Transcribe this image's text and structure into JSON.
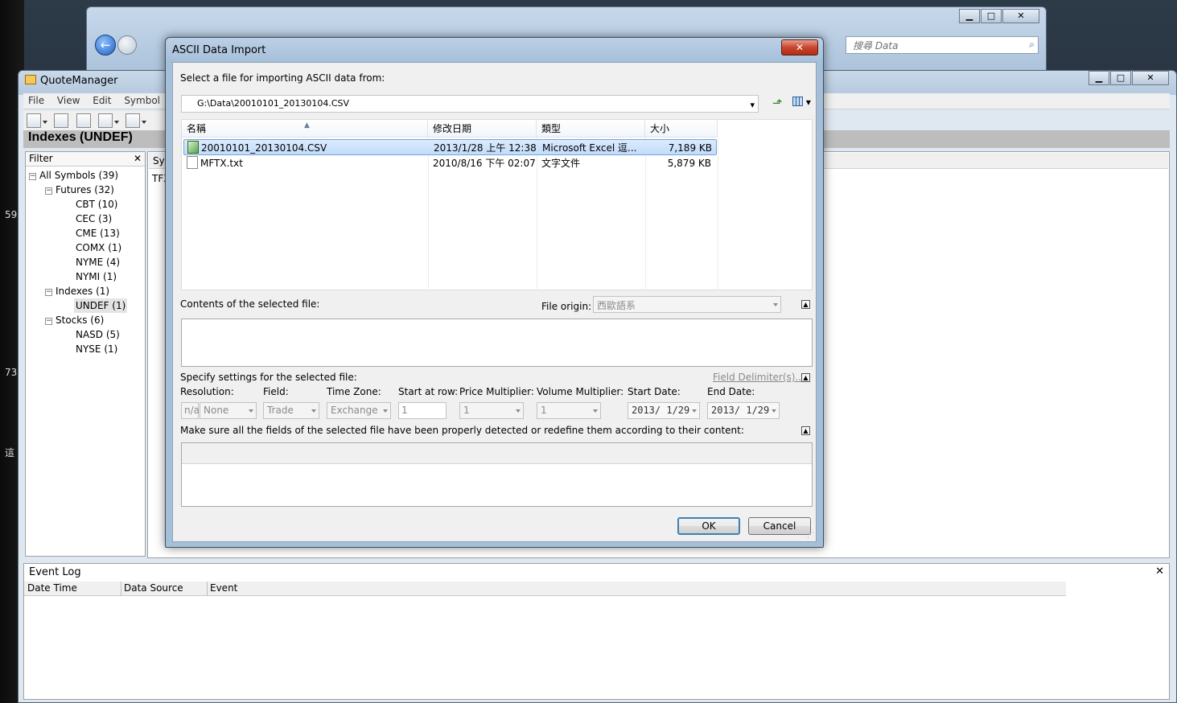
{
  "desktop": {
    "numbers": [
      "59",
      "73",
      "這"
    ]
  },
  "explorer": {
    "search_placeholder": "搜尋 Data",
    "controls": {
      "minimize": "▁",
      "maximize": "□",
      "close": "✕"
    }
  },
  "quote_manager": {
    "title": "QuoteManager",
    "menu": [
      "File",
      "View",
      "Edit",
      "Symbol"
    ],
    "heading": "Indexes (UNDEF)",
    "filter_label": "Filter",
    "filter_close": "✕",
    "mid_header_partial": "Syr",
    "mid_row_partial": "TFX",
    "controls": {
      "minimize": "▁",
      "maximize": "□",
      "close": "✕"
    },
    "tree": [
      {
        "label": "All Symbols (39)",
        "level": 0,
        "expander": "−"
      },
      {
        "label": "Futures (32)",
        "level": 1,
        "expander": "−"
      },
      {
        "label": "CBT (10)",
        "level": 2
      },
      {
        "label": "CEC (3)",
        "level": 2
      },
      {
        "label": "CME (13)",
        "level": 2
      },
      {
        "label": "COMX (1)",
        "level": 2
      },
      {
        "label": "NYME (4)",
        "level": 2
      },
      {
        "label": "NYMI (1)",
        "level": 2
      },
      {
        "label": "Indexes (1)",
        "level": 1,
        "expander": "−"
      },
      {
        "label": "UNDEF (1)",
        "level": 2,
        "selected": true
      },
      {
        "label": "Stocks (6)",
        "level": 1,
        "expander": "−"
      },
      {
        "label": "NASD (5)",
        "level": 2
      },
      {
        "label": "NYSE (1)",
        "level": 2
      }
    ],
    "event_log": {
      "title": "Event Log",
      "close": "✕",
      "columns": [
        "Date Time",
        "Data Source",
        "Event"
      ]
    }
  },
  "dialog": {
    "title": "ASCII Data Import",
    "close": "✕",
    "select_prompt": "Select a file for importing ASCII data from:",
    "path": "G:\\Data\\20010101_20130104.CSV",
    "file_columns": [
      "名稱",
      "修改日期",
      "類型",
      "大小"
    ],
    "files": [
      {
        "name": "20010101_20130104.CSV",
        "modified": "2013/1/28 上午 12:38",
        "type": "Microsoft Excel 逗...",
        "size": "7,189 KB",
        "icon": "excel-csv-icon",
        "selected": true
      },
      {
        "name": "MFTX.txt",
        "modified": "2010/8/16 下午 02:07",
        "type": "文字文件",
        "size": "5,879 KB",
        "icon": "text-file-icon",
        "selected": false
      }
    ],
    "contents_label": "Contents of the selected file:",
    "file_origin_label": "File origin:",
    "file_origin_value": "西歐語系",
    "settings_label": "Specify settings for the selected file:",
    "field_delimiters_link": "Field Delimiter(s)...",
    "resolution_label": "Resolution:",
    "resolution_na": "n/a",
    "resolution_value": "None",
    "field_label": "Field:",
    "field_value": "Trade",
    "timezone_label": "Time Zone:",
    "timezone_value": "Exchange",
    "start_row_label": "Start at row:",
    "start_row_value": "1",
    "price_mult_label": "Price Multiplier:",
    "price_mult_value": "1",
    "volume_mult_label": "Volume Multiplier:",
    "volume_mult_value": "1",
    "start_date_label": "Start Date:",
    "start_date_value": "2013/ 1/29",
    "end_date_label": "End Date:",
    "end_date_value": "2013/ 1/29",
    "fields_instruction": "Make sure all the fields of the selected file have been properly detected or redefine them according to their content:",
    "ok_label": "OK",
    "cancel_label": "Cancel"
  }
}
